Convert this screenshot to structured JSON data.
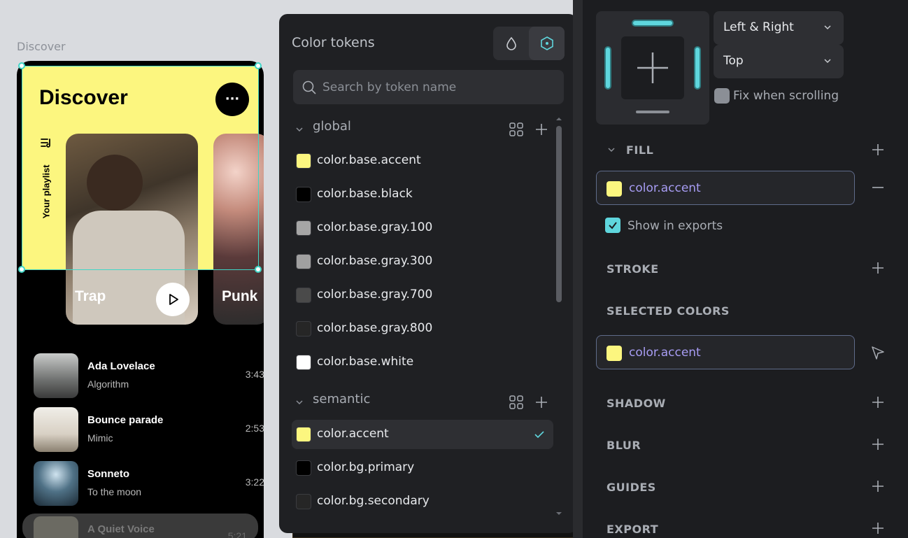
{
  "canvas": {
    "frame_label": "Discover",
    "hero": {
      "title": "Discover",
      "more_label": "···",
      "playlist_label": "Your playlist",
      "cards": [
        {
          "label": "Trap"
        },
        {
          "label": "Punk"
        }
      ]
    },
    "tracks": [
      {
        "title": "Ada Lovelace",
        "artist": "Algorithm",
        "duration": "3:43"
      },
      {
        "title": "Bounce parade",
        "artist": "Mimic",
        "duration": "2:53"
      },
      {
        "title": "Sonneto",
        "artist": "To the moon",
        "duration": "3:22"
      },
      {
        "title": "A Quiet Voice",
        "artist": "",
        "duration": "5:21"
      }
    ]
  },
  "tokens_panel": {
    "title": "Color tokens",
    "view_icons": [
      "drop-icon",
      "token-hexagon-icon"
    ],
    "search_placeholder": "Search by token name",
    "groups": [
      {
        "name": "global",
        "tokens": [
          {
            "name": "color.base.accent",
            "color": "#fcf67f",
            "selected": false
          },
          {
            "name": "color.base.black",
            "color": "#000000",
            "selected": false
          },
          {
            "name": "color.base.gray.100",
            "color": "#a6a6a6",
            "selected": false
          },
          {
            "name": "color.base.gray.300",
            "color": "#a0a0a0",
            "selected": false
          },
          {
            "name": "color.base.gray.700",
            "color": "#4a4a4a",
            "selected": false
          },
          {
            "name": "color.base.gray.800",
            "color": "#262626",
            "selected": false
          },
          {
            "name": "color.base.white",
            "color": "#ffffff",
            "selected": false
          }
        ]
      },
      {
        "name": "semantic",
        "tokens": [
          {
            "name": "color.accent",
            "color": "#fcf67f",
            "selected": true
          },
          {
            "name": "color.bg.primary",
            "color": "#000000",
            "selected": false
          },
          {
            "name": "color.bg.secondary",
            "color": "#262626",
            "selected": false
          }
        ]
      }
    ]
  },
  "design_panel": {
    "constraint_horizontal": "Left & Right",
    "constraint_vertical": "Top",
    "fix_when_scrolling": "Fix when scrolling",
    "fill": {
      "title": "FILL",
      "token": "color.accent",
      "token_color": "#fcf67f",
      "show_in_exports": "Show in exports",
      "show_in_exports_checked": true
    },
    "stroke_title": "STROKE",
    "selected_colors": {
      "title": "SELECTED COLORS",
      "token": "color.accent",
      "token_color": "#fcf67f"
    },
    "shadow_title": "SHADOW",
    "blur_title": "BLUR",
    "guides_title": "GUIDES",
    "export_title": "EXPORT"
  },
  "colors": {
    "accent": "#fcf67f",
    "selection": "#3fd6c7",
    "panel_bg": "#1f2023",
    "token_link_text": "#a79cf3"
  }
}
